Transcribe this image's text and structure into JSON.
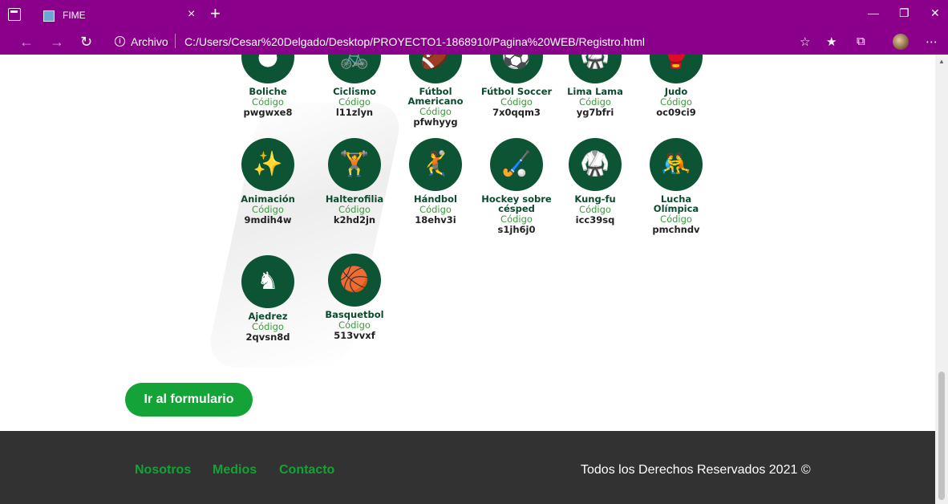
{
  "browser": {
    "tab_title": "FIME",
    "tab_close": "×",
    "new_tab": "+",
    "address_protocol": "Archivo",
    "address_url": "C:/Users/Cesar%20Delgado/Desktop/PROYECTO1-1868910/Pagina%20WEB/Registro.html",
    "icons": [
      "back-icon",
      "forward-icon",
      "refresh-icon",
      "info-icon",
      "favorites-add-icon",
      "favorites-icon",
      "collections-icon",
      "profile-icon",
      "more-icon"
    ]
  },
  "sports": [
    {
      "name": "Boliche",
      "code_label": "Código",
      "code": "pwgwxe8"
    },
    {
      "name": "Ciclismo",
      "code_label": "Código",
      "code": "l11zlyn"
    },
    {
      "name": "Fútbol Americano",
      "code_label": "Código",
      "code": "pfwhyyg"
    },
    {
      "name": "Fútbol Soccer",
      "code_label": "Código",
      "code": "7x0qqm3"
    },
    {
      "name": "Lima Lama",
      "code_label": "Código",
      "code": "yg7bfri"
    },
    {
      "name": "Judo",
      "code_label": "Código",
      "code": "oc09ci9"
    },
    {
      "name": "Animación",
      "code_label": "Código",
      "code": "9mdih4w"
    },
    {
      "name": "Halterofilia",
      "code_label": "Código",
      "code": "k2hd2jn"
    },
    {
      "name": "Hándbol",
      "code_label": "Código",
      "code": "18ehv3i"
    },
    {
      "name": "Hockey sobre césped",
      "code_label": "Código",
      "code": "s1jh6j0"
    },
    {
      "name": "Kung-fu",
      "code_label": "Código",
      "code": "icc39sq"
    },
    {
      "name": "Lucha Olímpica",
      "code_label": "Código",
      "code": "pmchndv"
    },
    {
      "name": "Ajedrez",
      "code_label": "Código",
      "code": "2qvsn8d"
    },
    {
      "name": "Basquetbol",
      "code_label": "Código",
      "code": "513vvxf"
    }
  ],
  "cta_label": "Ir al formulario",
  "footer": {
    "links": [
      "Nosotros",
      "Medios",
      "Contacto"
    ],
    "copyright": "Todos los Derechos Reservados 2021 ©"
  },
  "colors": {
    "chrome": "#8b008b",
    "icon_green": "#0c5434",
    "accent_green": "#13a336",
    "footer": "#323232"
  }
}
